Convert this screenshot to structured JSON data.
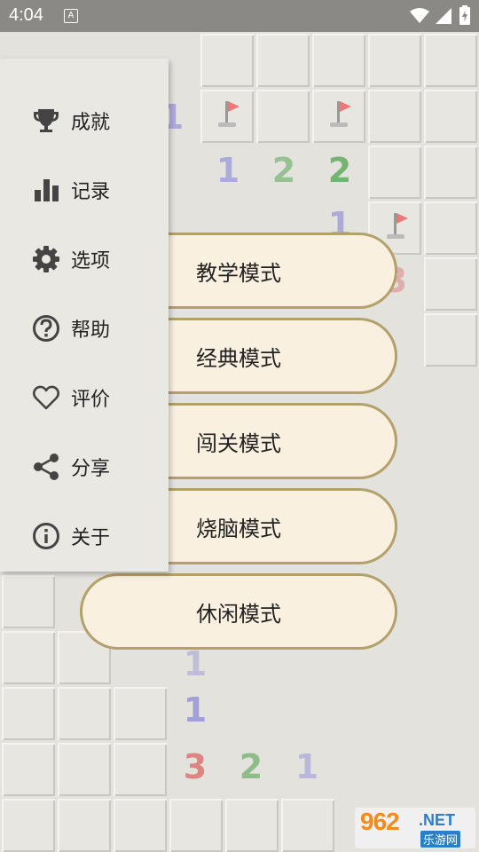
{
  "status_bar": {
    "time": "4:04",
    "notification_icon": "A"
  },
  "menu": {
    "items": [
      {
        "icon": "trophy-icon",
        "label": "成就"
      },
      {
        "icon": "bar-chart-icon",
        "label": "记录"
      },
      {
        "icon": "gear-icon",
        "label": "选项"
      },
      {
        "icon": "help-icon",
        "label": "帮助"
      },
      {
        "icon": "heart-icon",
        "label": "评价"
      },
      {
        "icon": "share-icon",
        "label": "分享"
      },
      {
        "icon": "info-icon",
        "label": "关于"
      }
    ]
  },
  "modes": [
    {
      "label": "教学模式"
    },
    {
      "label": "经典模式"
    },
    {
      "label": "闯关模式"
    },
    {
      "label": "烧脑模式"
    },
    {
      "label": "休闲模式"
    }
  ],
  "board": {
    "numbers": [
      "1",
      "1",
      "2",
      "2",
      "1",
      "3",
      "1",
      "1",
      "3",
      "2",
      "1"
    ]
  },
  "watermark": {
    "brand": "962",
    "domain": ".NET",
    "site": "乐游网"
  },
  "colors": {
    "button_fill": "#f9f0e0",
    "button_border": "#b4a06b",
    "drawer_bg": "#eae8e3",
    "status_bar": "#8a8985",
    "num_1": "#6b6bd6",
    "num_2": "#3a9a3a",
    "num_3": "#d63a3a"
  }
}
